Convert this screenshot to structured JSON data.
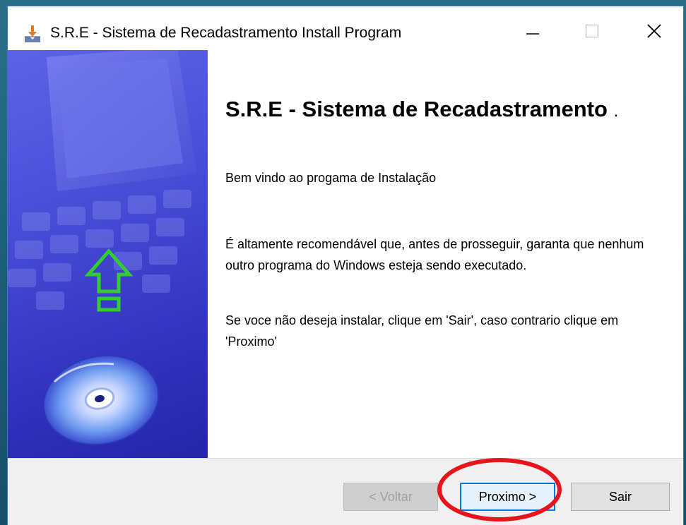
{
  "window": {
    "title": "S.R.E - Sistema de Recadastramento Install Program",
    "app_icon": "installer-download-icon",
    "controls": [
      "minimize-icon",
      "maximize-icon",
      "close-icon"
    ]
  },
  "sidebar": {
    "artwork": [
      "monitor-graphic",
      "keyboard-graphic",
      "upload-arrow-icon",
      "cd-disc-icon"
    ],
    "accent_color": "#33cc33"
  },
  "content": {
    "heading": "S.R.E - Sistema de Recadastramento",
    "heading_suffix": ".",
    "welcome": "Bem vindo ao progama de Instalação",
    "recommendation": "É altamente recomendável que, antes de prosseguir, garanta que nenhum outro programa do Windows esteja sendo executado.",
    "instructions": "Se voce não deseja instalar, clique em 'Sair', caso contrario clique em 'Proximo'"
  },
  "footer": {
    "back_label": "< Voltar",
    "next_label": "Proximo >",
    "exit_label": "Sair"
  },
  "annotation": {
    "highlight_color": "#e8141c"
  }
}
